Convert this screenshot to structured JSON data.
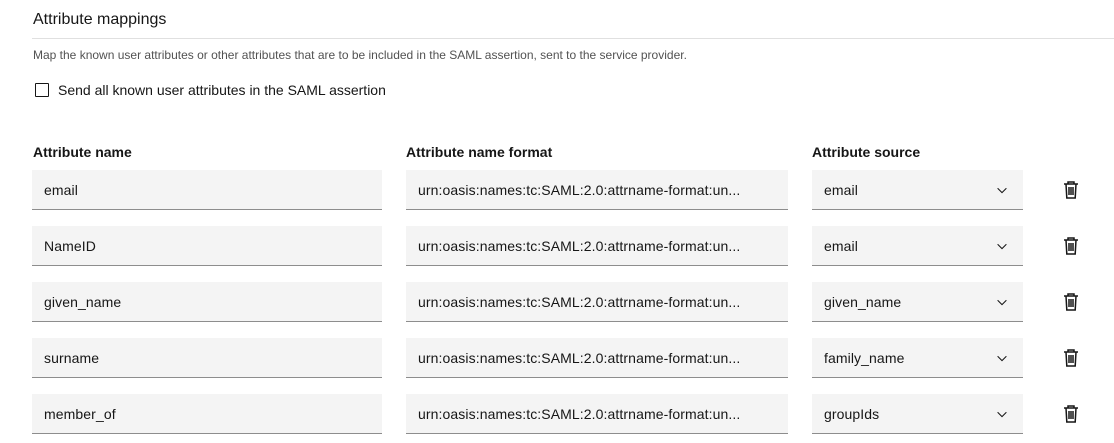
{
  "section": {
    "title": "Attribute mappings",
    "description": "Map the known user attributes or other attributes that are to be included in the SAML assertion, sent to the service provider."
  },
  "send_all": {
    "label": "Send all known user attributes in the SAML assertion",
    "checked": false
  },
  "columns": {
    "name": "Attribute name",
    "format": "Attribute name format",
    "source": "Attribute source"
  },
  "rows": [
    {
      "name": "email",
      "format": "urn:oasis:names:tc:SAML:2.0:attrname-format:un...",
      "source": "email"
    },
    {
      "name": "NameID",
      "format": "urn:oasis:names:tc:SAML:2.0:attrname-format:un...",
      "source": "email"
    },
    {
      "name": "given_name",
      "format": "urn:oasis:names:tc:SAML:2.0:attrname-format:un...",
      "source": "given_name"
    },
    {
      "name": "surname",
      "format": "urn:oasis:names:tc:SAML:2.0:attrname-format:un...",
      "source": "family_name"
    },
    {
      "name": "member_of",
      "format": "urn:oasis:names:tc:SAML:2.0:attrname-format:un...",
      "source": "groupIds"
    }
  ],
  "icons": {
    "dropdown": "chevron-down-icon",
    "delete": "trash-icon"
  }
}
